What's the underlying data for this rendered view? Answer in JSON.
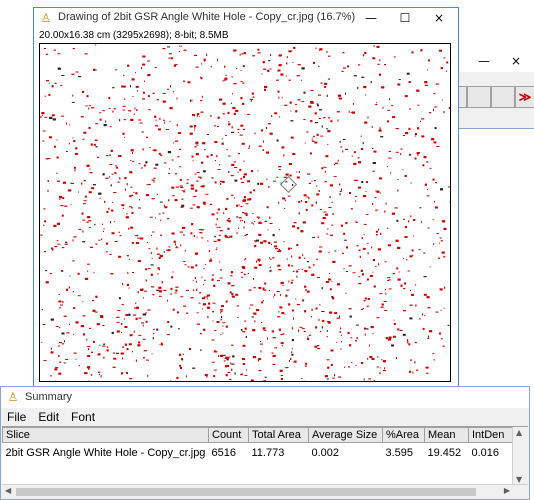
{
  "toolbar_window": {
    "minimize": "—",
    "close": "×",
    "more": "≫",
    "more_color": "#c00000"
  },
  "image_window": {
    "app_icon": "imagej-microscope-icon",
    "title": "Drawing of 2bit GSR Angle White Hole - Copy_cr.jpg (16.7%)",
    "info": "20.00x16.38 cm (3295x2698); 8-bit; 8.5MB",
    "minimize": "—",
    "maximize": "☐",
    "close": "×",
    "particle_color": "#cc0000"
  },
  "summary_window": {
    "app_icon": "imagej-microscope-icon",
    "title": "Summary",
    "minimize": "—",
    "maximize": "☐",
    "close": "×",
    "menu": [
      "File",
      "Edit",
      "Font"
    ],
    "columns": [
      "Slice",
      "Count",
      "Total Area",
      "Average Size",
      "%Area",
      "Mean",
      "IntDen"
    ],
    "rows": [
      [
        "2bit GSR Angle White Hole - Copy_cr.jpg",
        "6516",
        "11.773",
        "0.002",
        "3.595",
        "19.452",
        "0.016"
      ]
    ]
  }
}
